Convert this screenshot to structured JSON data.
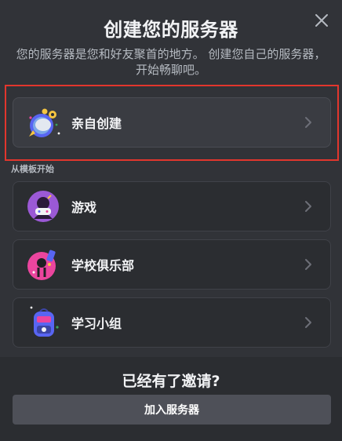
{
  "modal": {
    "title": "创建您的服务器",
    "subtitle": "您的服务器是您和好友聚首的地方。 创建您自己的服务器，开始畅聊吧。"
  },
  "create_option": {
    "label": "亲自创建",
    "icon": "create-own-icon"
  },
  "templates": {
    "section_label": "从模板开始",
    "items": [
      {
        "label": "游戏",
        "icon": "gaming-icon"
      },
      {
        "label": "学校俱乐部",
        "icon": "school-club-icon"
      },
      {
        "label": "学习小组",
        "icon": "study-group-icon"
      }
    ]
  },
  "footer": {
    "title": "已经有了邀请?",
    "join_button": "加入服务器"
  },
  "colors": {
    "highlight_border": "#e2362d",
    "modal_bg": "#313338",
    "footer_bg": "#2b2d31"
  }
}
